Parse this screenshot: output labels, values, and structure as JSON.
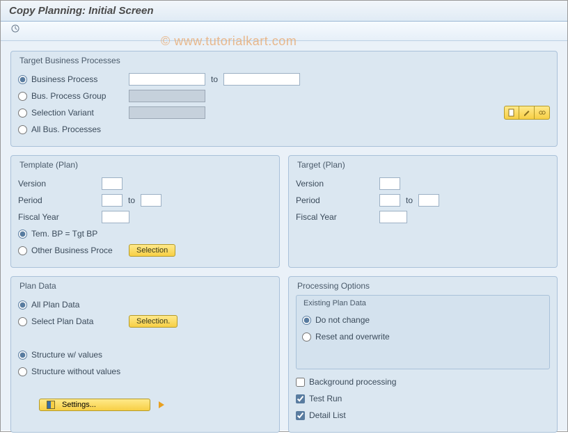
{
  "title": "Copy Planning: Initial Screen",
  "watermark": "© www.tutorialkart.com",
  "groups": {
    "target_bp": {
      "title": "Target Business Processes",
      "opt_business_process": "Business Process",
      "opt_bus_process_group": "Bus. Process Group",
      "opt_selection_variant": "Selection Variant",
      "opt_all_bus_processes": "All Bus. Processes",
      "to": "to"
    },
    "template_plan": {
      "title": "Template (Plan)",
      "version": "Version",
      "period": "Period",
      "to": "to",
      "fiscal_year": "Fiscal Year",
      "opt_tem_bp": "Tem. BP = Tgt BP",
      "opt_other_bp": "Other Business Proce",
      "btn_selection": "Selection"
    },
    "target_plan": {
      "title": "Target (Plan)",
      "version": "Version",
      "period": "Period",
      "to": "to",
      "fiscal_year": "Fiscal Year"
    },
    "plan_data": {
      "title": "Plan Data",
      "opt_all_plan_data": "All Plan Data",
      "opt_select_plan_data": "Select Plan Data",
      "btn_selection": "Selection.",
      "opt_struct_with_values": "Structure w/ values",
      "opt_struct_without_values": "Structure without values",
      "btn_settings": "Settings..."
    },
    "processing": {
      "title": "Processing Options",
      "existing_title": "Existing Plan Data",
      "opt_do_not_change": "Do not change",
      "opt_reset_overwrite": "Reset and overwrite",
      "chk_background": "Background processing",
      "chk_test_run": "Test Run",
      "chk_detail_list": "Detail List"
    }
  }
}
